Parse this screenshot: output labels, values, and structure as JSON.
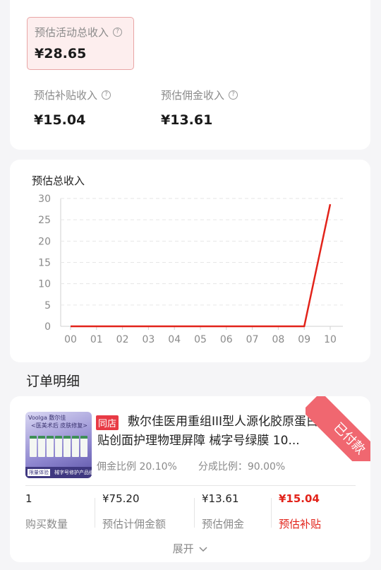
{
  "summary": {
    "total_label": "预估活动总收入",
    "total_amount": "¥28.65",
    "subsidy_label": "预估补贴收入",
    "subsidy_amount": "¥15.04",
    "commission_label": "预估佣金收入",
    "commission_amount": "¥13.61",
    "help_icon": "question-circle-icon"
  },
  "chart_data": {
    "type": "line",
    "title": "预估总收入",
    "categories": [
      "00",
      "01",
      "02",
      "03",
      "04",
      "05",
      "06",
      "07",
      "08",
      "09",
      "10"
    ],
    "values": [
      0,
      0,
      0,
      0,
      0,
      0,
      0,
      0,
      0,
      0,
      28.65
    ],
    "ylim": [
      0,
      30
    ],
    "yticks": [
      0,
      5,
      10,
      15,
      20,
      25,
      30
    ],
    "grid": "dashed-horizontal",
    "line_color": "#e2231a"
  },
  "orders": {
    "section_title": "订单明细",
    "item": {
      "thumbnail": {
        "brand": "Voolga 敷尔佳",
        "tagline": "<医美术后 皮肤修复>",
        "footer_tag": "限量体验",
        "footer_text": "械字号修护产品组合"
      },
      "shop_tag": "同店",
      "title": "敷尔佳医用重组III型人源化胶原蛋白贴创面护理物理屏障 械字号绿膜 10...",
      "commission_rate": "佣金比例 20.10%",
      "share_rate": "分成比例：90.00%",
      "status_ribbon": "已付款",
      "stats": [
        {
          "value": "1",
          "label": "购买数量"
        },
        {
          "value": "¥75.20",
          "label": "预估计佣金额"
        },
        {
          "value": "¥13.61",
          "label": "预估佣金"
        },
        {
          "value": "¥15.04",
          "label": "预估补贴"
        }
      ],
      "expand_label": "展开",
      "expand_icon": "chevron-down-icon"
    }
  },
  "colors": {
    "accent_red": "#e2231a",
    "total_box_bg": "#fdeeee",
    "ribbon": "#f06770"
  }
}
